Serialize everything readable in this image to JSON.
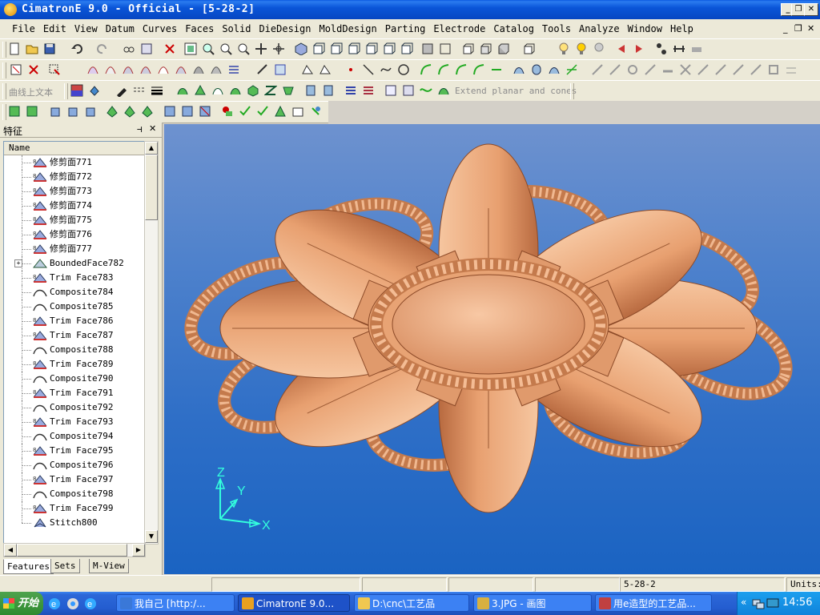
{
  "window": {
    "title": "CimatronE 9.0 - Official - [5-28-2]",
    "controls": [
      "_",
      "❐",
      "✕"
    ]
  },
  "menu": {
    "items": [
      {
        "label": "File",
        "key": "F"
      },
      {
        "label": "Edit",
        "key": "E"
      },
      {
        "label": "View",
        "key": "V"
      },
      {
        "label": "Datum",
        "key": ""
      },
      {
        "label": "Curves",
        "key": "C"
      },
      {
        "label": "Faces",
        "key": "a"
      },
      {
        "label": "Solid",
        "key": "S"
      },
      {
        "label": "DieDesign",
        "key": ""
      },
      {
        "label": "MoldDesign",
        "key": "M"
      },
      {
        "label": "Parting",
        "key": ""
      },
      {
        "label": "Electrode",
        "key": ""
      },
      {
        "label": "Catalog",
        "key": ""
      },
      {
        "label": "Tools",
        "key": "T"
      },
      {
        "label": "Analyze",
        "key": "A"
      },
      {
        "label": "Window",
        "key": "W"
      },
      {
        "label": "Help",
        "key": "H"
      }
    ],
    "mdi_controls": [
      "_",
      "❐",
      "✕"
    ]
  },
  "toolbar3": {
    "curve_text_label": "曲线上文本",
    "extend_label": "Extend planar and cones"
  },
  "panel": {
    "title": "特征",
    "pin": "⊣",
    "close": "✕",
    "column_header": "Name",
    "rows": [
      {
        "label": "修剪面771",
        "kind": "trim"
      },
      {
        "label": "修剪面772",
        "kind": "trim"
      },
      {
        "label": "修剪面773",
        "kind": "trim"
      },
      {
        "label": "修剪面774",
        "kind": "trim"
      },
      {
        "label": "修剪面775",
        "kind": "trim"
      },
      {
        "label": "修剪面776",
        "kind": "trim"
      },
      {
        "label": "修剪面777",
        "kind": "trim"
      },
      {
        "label": "BoundedFace782",
        "kind": "bounded"
      },
      {
        "label": "Trim Face783",
        "kind": "trim"
      },
      {
        "label": "Composite784",
        "kind": "composite"
      },
      {
        "label": "Composite785",
        "kind": "composite"
      },
      {
        "label": "Trim Face786",
        "kind": "trim"
      },
      {
        "label": "Trim Face787",
        "kind": "trim"
      },
      {
        "label": "Composite788",
        "kind": "composite"
      },
      {
        "label": "Trim Face789",
        "kind": "trim"
      },
      {
        "label": "Composite790",
        "kind": "composite"
      },
      {
        "label": "Trim Face791",
        "kind": "trim"
      },
      {
        "label": "Composite792",
        "kind": "composite"
      },
      {
        "label": "Trim Face793",
        "kind": "trim"
      },
      {
        "label": "Composite794",
        "kind": "composite"
      },
      {
        "label": "Trim Face795",
        "kind": "trim"
      },
      {
        "label": "Composite796",
        "kind": "composite"
      },
      {
        "label": "Trim Face797",
        "kind": "trim"
      },
      {
        "label": "Composite798",
        "kind": "composite"
      },
      {
        "label": "Trim Face799",
        "kind": "trim"
      },
      {
        "label": "Stitch800",
        "kind": "stitch"
      }
    ],
    "tabs": [
      "Features",
      "Sets",
      "M-View"
    ]
  },
  "viewport": {
    "axis_x": "X",
    "axis_y": "Y",
    "axis_z": "Z",
    "model_color": "#e8a070"
  },
  "status": {
    "file": "5-28-2",
    "units": "Units:"
  },
  "taskbar": {
    "start": "开始",
    "tasks": [
      {
        "label": "我自己 [http:/...",
        "color": "#3a78d8"
      },
      {
        "label": "CimatronE 9.0...",
        "color": "#e8a020"
      },
      {
        "label": "D:\\cnc\\工艺品",
        "color": "#f0c850"
      },
      {
        "label": "3.JPG - 画图",
        "color": "#d8b040"
      },
      {
        "label": "用e造型的工艺品...",
        "color": "#c04040"
      }
    ],
    "clock": "14:56",
    "tray_chevron": "«"
  }
}
